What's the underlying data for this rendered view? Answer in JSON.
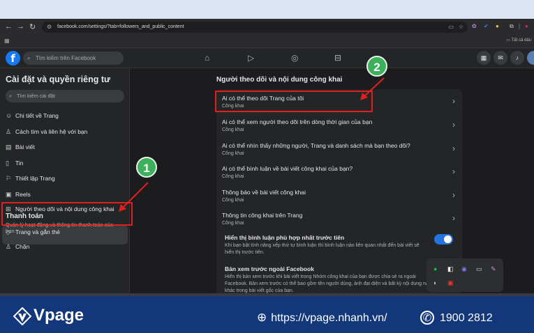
{
  "browser": {
    "url": "facebook.com/settings/?tab=followers_and_public_content",
    "bookmark_right": "Tất cả dấu"
  },
  "fb": {
    "logo": "f",
    "search_placeholder": "Tìm kiếm trên Facebook"
  },
  "sidebar": {
    "title": "Cài đặt và quyền riêng tư",
    "search_placeholder": "Tìm kiếm cài đặt",
    "items": [
      {
        "label": "Chi tiết về Trang",
        "icon": "person-circle-icon"
      },
      {
        "label": "Cách tìm và liên hệ với bạn",
        "icon": "people-icon"
      },
      {
        "label": "Bài viết",
        "icon": "feed-icon"
      },
      {
        "label": "Tin",
        "icon": "book-icon"
      },
      {
        "label": "Thiết lập Trang",
        "icon": "flag-icon"
      },
      {
        "label": "Reels",
        "icon": "reels-icon"
      },
      {
        "label": "Người theo dõi và nội dung công khai",
        "icon": "add-square-icon"
      },
      {
        "label": "Trang và gắn thẻ",
        "icon": "tag-icon"
      },
      {
        "label": "Chặn",
        "icon": "block-person-icon"
      }
    ],
    "section_title": "Thanh toán",
    "section_desc": "Quản lý hoạt động và thông tin thanh toán của bạn."
  },
  "main": {
    "title": "Người theo dõi và nội dung công khai",
    "rows": [
      {
        "title": "Ai có thể theo dõi Trang của tôi",
        "sub": "Công khai"
      },
      {
        "title": "Ai có thể xem người theo dõi trên dòng thời gian của bạn",
        "sub": "Công khai"
      },
      {
        "title": "Ai có thể nhìn thấy những người, Trang và danh sách mà bạn theo dõi?",
        "sub": "Công khai"
      },
      {
        "title": "Ai có thể bình luận về bài viết công khai của bạn?",
        "sub": "Công khai"
      },
      {
        "title": "Thông báo về bài viết công khai",
        "sub": "Công khai"
      },
      {
        "title": "Thông tin công khai trên Trang",
        "sub": "Công khai"
      }
    ],
    "toggle_title": "Hiển thị bình luận phù hợp nhất trước tiên",
    "toggle_desc": "Khi bạn bật tính năng xếp thứ tự bình luận thì bình luận nào liên quan nhất đến bài viết sẽ hiển thị trước tiên.",
    "toggle_on": true,
    "preview_title": "Bản xem trước ngoài Facebook",
    "preview_desc": "Hiển thị bản xem trước khi bài viết trong Nhóm công khai của bạn được chia sẻ ra ngoài Facebook. Bản xem trước có thể bao gồm tên người dùng, ảnh đại diện và bất kỳ nội dung nào khác trong bài viết gốc của bạn."
  },
  "annotations": {
    "badge1": "1",
    "badge2": "2",
    "highlight_color": "#e02020",
    "badge_color": "#3daf5d"
  },
  "footer": {
    "brand": "Vpage",
    "website": "https://vpage.nhanh.vn/",
    "phone": "1900 2812",
    "bg": "#12377a"
  }
}
